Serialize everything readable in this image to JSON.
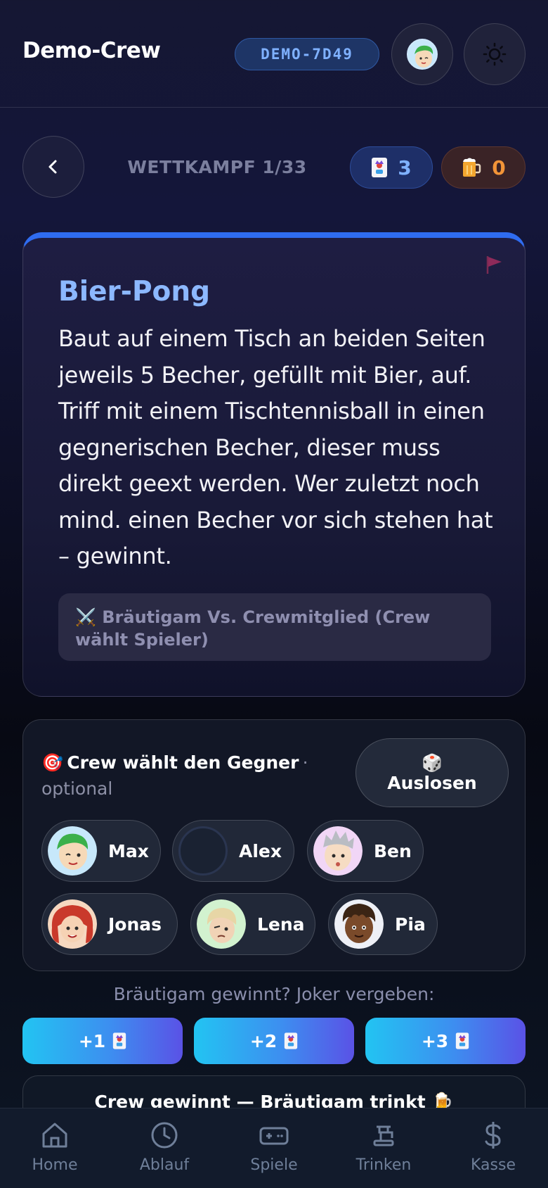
{
  "header": {
    "title": "Demo-Crew",
    "room_code": "DEMO-7D49"
  },
  "round": {
    "label": "WETTKAMPF 1/33",
    "joker_count": "3",
    "beer_count": "0"
  },
  "game": {
    "title": "Bier-Pong",
    "description": "Baut auf einem Tisch an beiden Seiten jeweils 5 Becher, gefüllt mit Bier, auf. Triff mit einem Tischtennisball in einen gegnerischen Becher, dieser muss direkt geext werden. Wer zuletzt noch mind. einen Becher vor sich stehen hat – gewinnt.",
    "mode_icon": "⚔️",
    "mode": "Bräutigam Vs. Crewmitglied (Crew wählt Spieler)"
  },
  "crew_select": {
    "icon": "🎯",
    "title": "Crew wählt den Gegner",
    "separator": "·",
    "optional": "optional",
    "draw_icon": "🎲",
    "draw_label": "Auslosen",
    "players": [
      {
        "name": "Max"
      },
      {
        "name": "Alex"
      },
      {
        "name": "Ben"
      },
      {
        "name": "Jonas"
      },
      {
        "name": "Lena"
      },
      {
        "name": "Pia"
      }
    ]
  },
  "joker_award": {
    "label": "Bräutigam gewinnt? Joker vergeben:",
    "buttons": [
      {
        "label": "+1"
      },
      {
        "label": "+2"
      },
      {
        "label": "+3"
      }
    ]
  },
  "crew_wins": {
    "label": "Crew gewinnt — Bräutigam trinkt 🍺"
  },
  "nav": {
    "items": [
      {
        "label": "Home"
      },
      {
        "label": "Ablauf"
      },
      {
        "label": "Spiele"
      },
      {
        "label": "Trinken"
      },
      {
        "label": "Kasse"
      }
    ]
  },
  "colors": {
    "accent_blue": "#2f6cf0",
    "title_blue": "#8cb8ff",
    "beer_orange": "#f29438",
    "gradient_start": "#22c4f2",
    "gradient_end": "#5a52e6"
  },
  "icons": [
    "user-avatar-icon",
    "sun-icon",
    "chevron-left-icon",
    "joker-card-icon",
    "beer-mug-icon",
    "flag-icon",
    "home-icon",
    "clock-icon",
    "gamepad-icon",
    "beer-tap-icon",
    "dollar-icon"
  ]
}
